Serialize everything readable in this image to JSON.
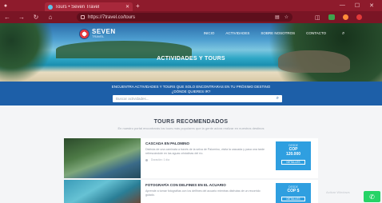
{
  "browser": {
    "tab_title": "Tours • Seven Travel",
    "url": "https://7travel.co/tours"
  },
  "site": {
    "logo_main": "SEVEN",
    "logo_sub": "TRAVEL",
    "menu": [
      "INICIO",
      "ACTIVIDADES",
      "SOBRE NOSOTROS",
      "CONTACTO"
    ],
    "hero_title": "ACTIVIDADES Y TOURS",
    "band_line1": "ENCUENTRA ACTIVIDADES Y TOURS QUE SOLO ENCONTRARAS EN TU PRÓXIMO DESTINO",
    "band_line2": "¿DÓNDE QUIERES IR?",
    "search_placeholder": "Buscar actividades..."
  },
  "section": {
    "title": "TOURS RECOMENDADOS",
    "subtitle": "En nuestro portal encontrarás los tours más populares que la gente adora realizar en nuestros destinos"
  },
  "tours": [
    {
      "title": "CASCADA EN PALOMINO",
      "desc": "Disfruta de una caminata a través de la selva de Palomino, visita la cascada y pasa una tarde refrescándote en las aguas cristalinas del río.",
      "meta": "Duración: 1 día",
      "price_from": "DESDE",
      "currency": "COP",
      "amount": "120.000",
      "button": "DETALLES"
    },
    {
      "title": "FOTOGRAFÍA CON DELFINES EN EL ACUARIO",
      "desc": "Aprende a tomar fotografías con los delfines del acuario mientras disfrutas de un recorrido guiado.",
      "meta": "",
      "price_from": "DESDE",
      "currency": "COP $",
      "amount": "",
      "button": "DETALLES"
    }
  ],
  "watermark": "Activar Windows"
}
